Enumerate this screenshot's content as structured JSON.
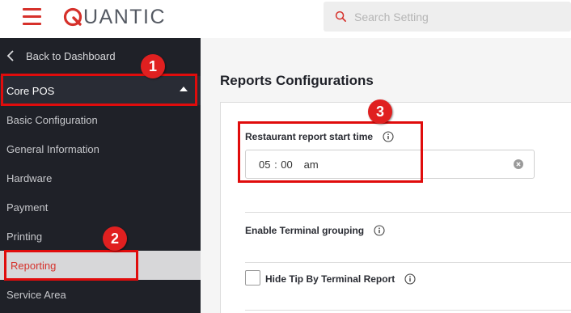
{
  "header": {
    "logo_initial": "Q",
    "logo_text": "UANTIC",
    "search_placeholder": "Search Setting"
  },
  "sidebar": {
    "back_label": "Back to Dashboard",
    "section_label": "Core POS",
    "items": [
      {
        "label": "Basic Configuration",
        "active": false
      },
      {
        "label": "General Information",
        "active": false
      },
      {
        "label": "Hardware",
        "active": false
      },
      {
        "label": "Payment",
        "active": false
      },
      {
        "label": "Printing",
        "active": false
      },
      {
        "label": "Reporting",
        "active": true
      },
      {
        "label": "Service Area",
        "active": false
      }
    ]
  },
  "main": {
    "title": "Reports Configurations",
    "start_time": {
      "label": "Restaurant report start time",
      "value": "05 : 00   am"
    },
    "terminal_grouping_label": "Enable Terminal grouping",
    "hide_tip_label": "Hide Tip By Terminal Report",
    "hide_tip_checked": false
  },
  "annotations": [
    {
      "number": "1"
    },
    {
      "number": "2"
    },
    {
      "number": "3"
    }
  ],
  "colors": {
    "brand_red": "#d6312b",
    "sidebar_bg": "#1f2128",
    "annotation_red": "#e00c0c"
  }
}
